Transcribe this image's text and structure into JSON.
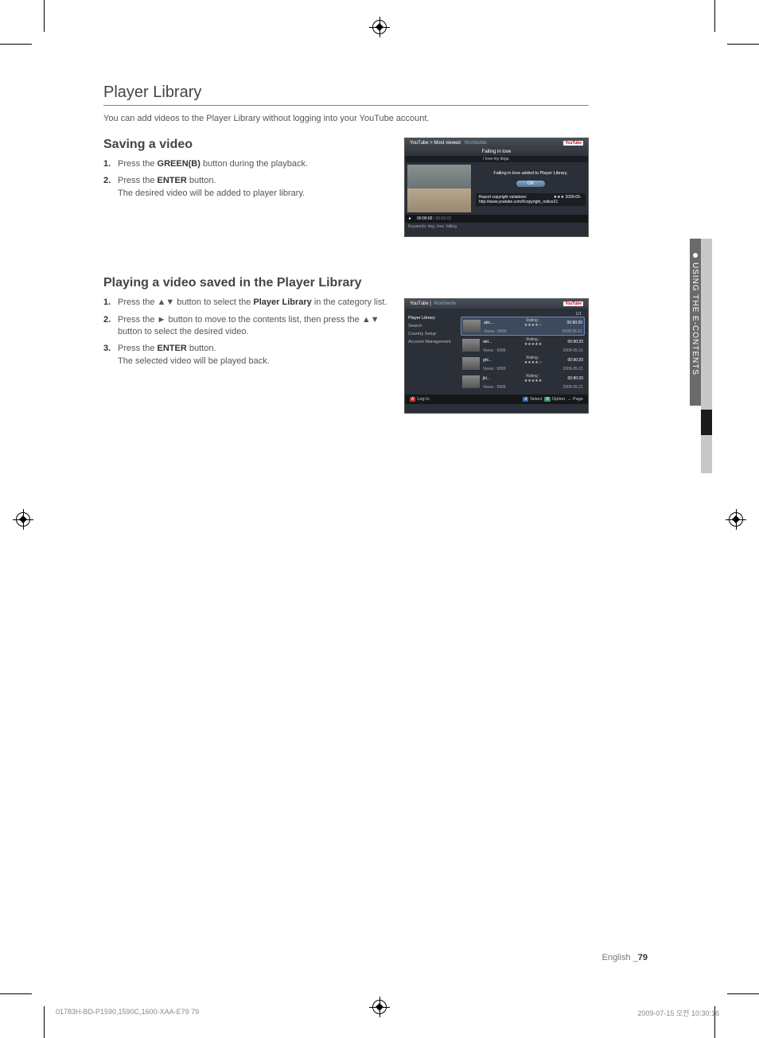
{
  "main_heading": "Player Library",
  "intro": "You can add videos to the Player Library without logging into your YouTube account.",
  "section1": {
    "heading": "Saving a video",
    "steps": [
      {
        "num": "1.",
        "pre": "Press the ",
        "bold": "GREEN(B)",
        "post": " button during the playback."
      },
      {
        "num": "2.",
        "pre": "Press the ",
        "bold": "ENTER",
        "post": " button.",
        "line2": "The desired video will be added to player library."
      }
    ]
  },
  "section2": {
    "heading": "Playing a video saved in the Player Library",
    "steps": [
      {
        "num": "1.",
        "text_a": "Press the ",
        "sym": "▲▼",
        "text_b": " button to select the ",
        "bold": "Player Library",
        "text_c": " in the category list."
      },
      {
        "num": "2.",
        "text_a": "Press the ",
        "sym1": "►",
        "text_b": " button to move to the contents list, then press the ",
        "sym2": "▲▼",
        "text_c": " button to select the desired video."
      },
      {
        "num": "3.",
        "text_a": "Press the ",
        "bold": "ENTER",
        "text_b": " button.",
        "line2": "The selected video will be played back."
      }
    ]
  },
  "screenshot1": {
    "breadcrumb": "YouTube > Most viewed",
    "region": "Worldwide",
    "logo": "YouTube",
    "title": "Falling in love",
    "subtitle": "I love my dogs.",
    "message": "Falling in love added to Player Library.",
    "ok": "OK",
    "note_label": "Report copyright violations:",
    "note_url": "http://www.youtube.com/t/copyright_notice",
    "note_date": "★★★ 2009-05-21",
    "progress_cur": "00:00:00",
    "progress_total": "/ 00:00:23",
    "keywords_label": "Keywords: dog, love, falling",
    "play_icon": "►"
  },
  "screenshot2": {
    "breadcrumb": "YouTube |",
    "region": "Worldwide",
    "logo": "YouTube",
    "counter": "1/1",
    "sidebar": [
      "Player Library",
      "Search",
      "Country Setup",
      "Account Management"
    ],
    "rows": [
      {
        "title": "abc...",
        "views": "Views : 9999",
        "rating": "Rating : ★★★★☆",
        "time": "00:90:20",
        "date": "2009-05-21"
      },
      {
        "title": "def...",
        "views": "Views : 9999",
        "rating": "Rating : ★★★★★",
        "time": "00:90:20",
        "date": "2009-05-21"
      },
      {
        "title": "ghi...",
        "views": "Views : 9999",
        "rating": "Rating : ★★★★☆",
        "time": "00:90:20",
        "date": "2009-05-21"
      },
      {
        "title": "jkl...",
        "views": "Views : 9999",
        "rating": "Rating : ★★★★★",
        "time": "00:90:20",
        "date": "2009-05-21"
      }
    ],
    "footer": {
      "login_btn": "A",
      "login": "Log In",
      "select_btn": "d",
      "select": "Select",
      "option_btn": "B",
      "option": "Option",
      "page_btn": "↔",
      "page": "Page"
    }
  },
  "side_label": "USING THE E-CONTENTS",
  "footer_lang": "English _",
  "footer_page": "79",
  "print_left": "01783H-BD-P1590,1590C,1600-XAA-E79   79",
  "print_right": "2009-07-15   오전 10:30:16"
}
